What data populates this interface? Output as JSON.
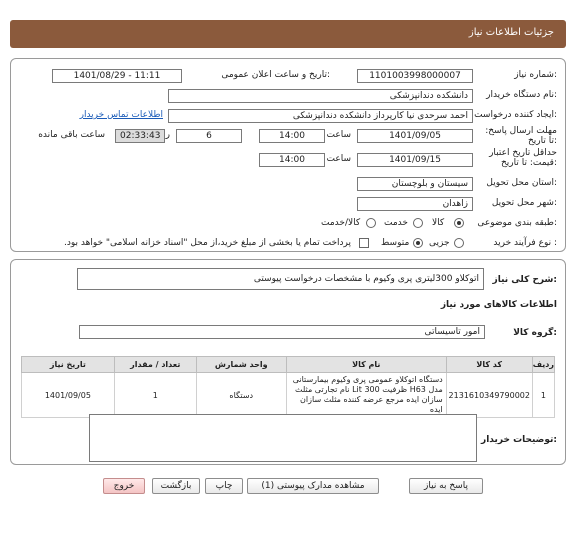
{
  "header": {
    "title": "جزئیات اطلاعات نیاز"
  },
  "form": {
    "need_number_label": "شماره نیاز:",
    "need_number": "1101003998000007",
    "announce_label": "تاریخ و ساعت اعلان عمومی:",
    "announce_value": "1401/08/29 - 11:11",
    "buyer_org_label": "نام دستگاه خریدار:",
    "buyer_org": "دانشکده دندانپزشکی",
    "creator_label": "ایجاد کننده درخواست:",
    "creator": "احمد سرحدی نیا کارپرداز دانشکده دندانپزشکی",
    "contact_link": "اطلاعات تماس خریدار",
    "reply_deadline_label": "مهلت ارسال پاسخ: تا تاریخ:",
    "reply_date": "1401/09/05",
    "time_label": "ساعت",
    "reply_time": "14:00",
    "days_value": "6",
    "days_label": "روز و",
    "remaining_time": "02:33:43",
    "remaining_label": "ساعت باقی مانده",
    "validity_label": "حداقل تاریخ اعتبار قیمت: تا تاریخ:",
    "validity_date": "1401/09/15",
    "validity_time_label": "ساعت",
    "validity_time": "14:00",
    "province_label": "استان محل تحویل:",
    "province": "سیستان و بلوچستان",
    "city_label": "شهر محل تحویل:",
    "city": "زاهدان",
    "category_label": "طبقه بندی موضوعی:",
    "category_options": [
      "کالا",
      "خدمت",
      "کالا/خدمت"
    ],
    "process_label": "نوع فرآیند خرید :",
    "process_options": [
      "جزیی",
      "متوسط"
    ],
    "payment_note": "پرداخت تمام یا بخشی از مبلغ خرید،از محل \"اسناد خزانه اسلامی\" خواهد بود."
  },
  "summary": {
    "label": "شرح کلی نیاز:",
    "value": "اتوکلاو 300لیتری پری وکیوم با مشخصات درخواست پیوستی"
  },
  "goods": {
    "section_title": "اطلاعات کالاهای مورد نیاز",
    "group_label": "گروه کالا:",
    "group_value": "امور تاسیساتی",
    "columns": [
      "ردیف",
      "کد کالا",
      "نام کالا",
      "واحد شمارش",
      "تعداد / مقدار",
      "تاریخ نیاز"
    ],
    "rows": [
      {
        "row": "1",
        "code": "2131610349790002",
        "name": "دستگاه اتوکلاو عمومی پری وکیوم بیمارستانی مدل H63 ظرفیت 300 Lit نام تجارتی مثلث سازان ایده مرجع عرضه کننده مثلث سازان ایده",
        "unit": "دستگاه",
        "qty": "1",
        "date": "1401/09/05"
      }
    ]
  },
  "buyer_notes": {
    "label": "توضیحات خریدار:",
    "value": ""
  },
  "buttons": {
    "reply": "پاسخ به نیاز",
    "attachments": "مشاهده مدارک پیوستی (1)",
    "print": "چاپ",
    "back": "بازگشت",
    "exit": "خروج"
  }
}
